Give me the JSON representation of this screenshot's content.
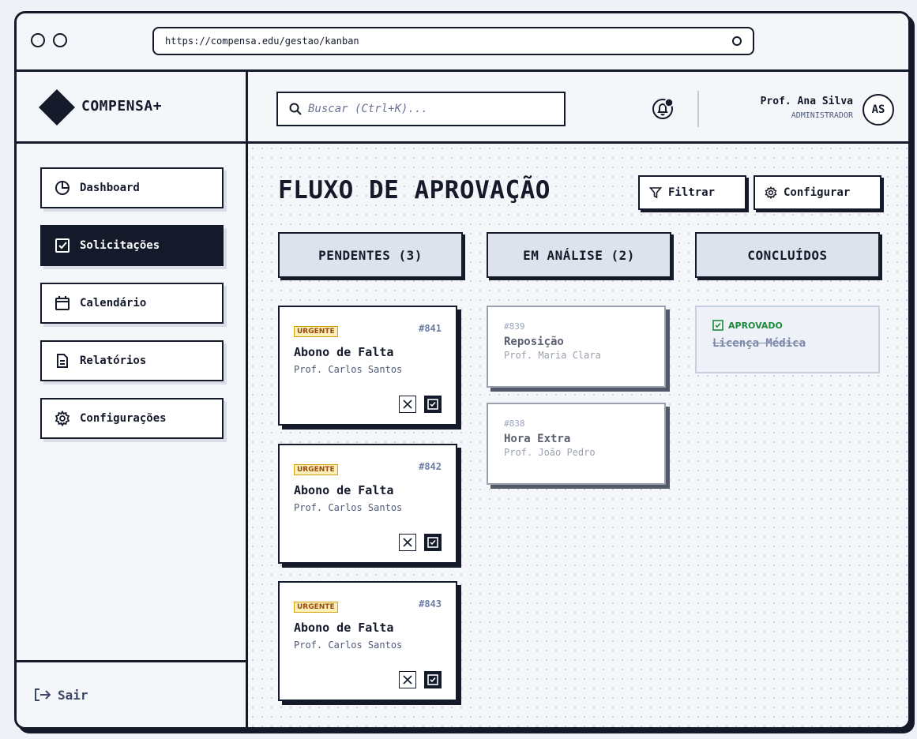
{
  "browser": {
    "url": "https://compensa.edu/gestao/kanban"
  },
  "brand": {
    "name": "COMPENSA+"
  },
  "sidebar": {
    "items": [
      {
        "label": "Dashboard",
        "icon": "pie-chart-icon",
        "active": false
      },
      {
        "label": "Solicitações",
        "icon": "checkbox-icon",
        "active": true
      },
      {
        "label": "Calendário",
        "icon": "calendar-icon",
        "active": false
      },
      {
        "label": "Relatórios",
        "icon": "document-icon",
        "active": false
      },
      {
        "label": "Configurações",
        "icon": "gear-icon",
        "active": false
      }
    ],
    "logout_label": "Sair"
  },
  "header": {
    "search_placeholder": "Buscar (Ctrl+K)...",
    "user_name": "Prof. Ana Silva",
    "user_role": "ADMINISTRADOR",
    "avatar_initials": "AS"
  },
  "main": {
    "title": "FLUXO DE APROVAÇÃO",
    "filter_label": "Filtrar",
    "config_label": "Configurar",
    "columns": [
      {
        "label": "PENDENTES (3)"
      },
      {
        "label": "EM ANÁLISE (2)"
      },
      {
        "label": "CONCLUÍDOS"
      }
    ],
    "pending": [
      {
        "badge": "URGENTE",
        "id": "#841",
        "title": "Abono de Falta",
        "teacher": "Prof. Carlos Santos"
      },
      {
        "badge": "URGENTE",
        "id": "#842",
        "title": "Abono de Falta",
        "teacher": "Prof. Carlos Santos"
      },
      {
        "badge": "URGENTE",
        "id": "#843",
        "title": "Abono de Falta",
        "teacher": "Prof. Carlos Santos"
      }
    ],
    "analysis": [
      {
        "id": "#839",
        "title": "Reposição",
        "teacher": "Prof. Maria Clara"
      },
      {
        "id": "#838",
        "title": "Hora Extra",
        "teacher": "Prof. João Pedro"
      }
    ],
    "done": [
      {
        "status": "APROVADO",
        "title": "Licença Médica"
      }
    ]
  },
  "colors": {
    "ink": "#151a2b",
    "accent_green": "#1e8a3c",
    "urgent_bg": "#fdefb9",
    "column_bg": "#dde2ec"
  }
}
